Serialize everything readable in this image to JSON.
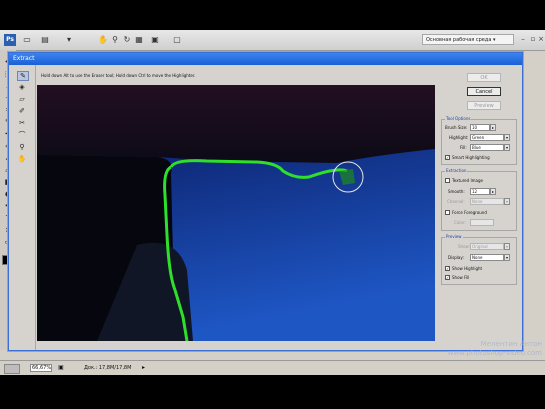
{
  "app": {
    "workspace": "Основная рабочая среда"
  },
  "dialog": {
    "title": "Extract",
    "hint": "Hold down Alt to use the Eraser tool; Hold down Ctrl to move the Highlighter.",
    "buttons": {
      "ok": "OK",
      "cancel": "Cancel",
      "preview": "Preview"
    },
    "tool_options": {
      "label": "Tool Options",
      "brush_size_label": "Brush Size:",
      "brush_size_value": "10",
      "highlight_label": "Highlight:",
      "highlight_value": "Green",
      "fill_label": "Fill:",
      "fill_value": "Blue",
      "smart_highlighting": "Smart Highlighting"
    },
    "extraction": {
      "label": "Extraction",
      "textured_image": "Textured Image",
      "smooth_label": "Smooth:",
      "smooth_value": "12",
      "channel_label": "Channel:",
      "channel_value": "None",
      "force_foreground": "Force Foreground",
      "color_label": "Color:"
    },
    "preview": {
      "label": "Preview",
      "show_label": "Show:",
      "show_value": "Original",
      "display_label": "Display:",
      "display_value": "None",
      "show_highlight": "Show Highlight",
      "show_fill": "Show Fill"
    }
  },
  "status": {
    "zoom": "66,67%",
    "doc": "Док.: 17,8M/17,8M"
  },
  "watermark": {
    "line1": "Мелентин Антон",
    "line2": "www.photoshop-video.com"
  }
}
